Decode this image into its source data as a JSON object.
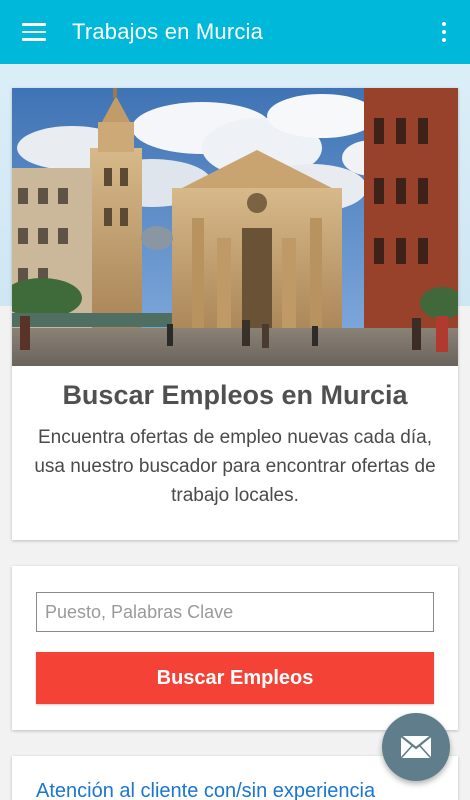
{
  "app_bar": {
    "title": "Trabajos en Murcia",
    "color": "#00b8d9",
    "menu_icon": "hamburger-menu-icon",
    "overflow_icon": "more-vertical-icon"
  },
  "hero": {
    "image": "murcia-cathedral-photo",
    "title": "Buscar Empleos en Murcia",
    "description": "Encuentra ofertas de empleo nuevas cada día, usa nuestro buscador para encontrar ofertas de trabajo locales."
  },
  "search": {
    "placeholder": "Puesto, Palabras Clave",
    "value": "",
    "button_label": "Buscar Empleos",
    "button_color": "#f44336"
  },
  "listing": {
    "first_link": "Atención al cliente con/sin experiencia"
  },
  "fab": {
    "icon": "envelope-icon",
    "color": "#607d8b"
  }
}
